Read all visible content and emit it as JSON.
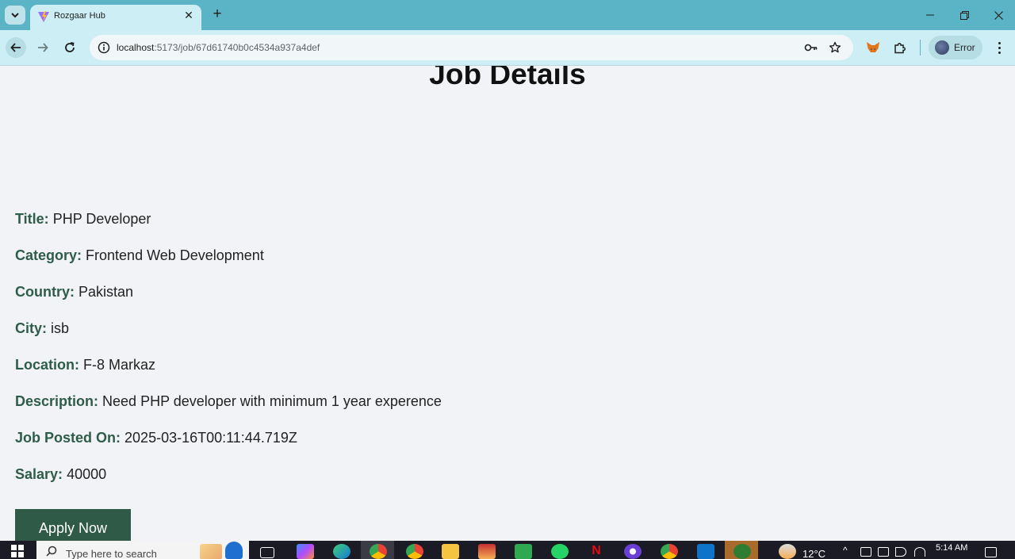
{
  "browser": {
    "tab_title": "Rozgaar Hub",
    "url_host": "localhost",
    "url_rest": ":5173/job/67d61740b0c4534a937a4def",
    "profile_label": "Error"
  },
  "page": {
    "heading": "Job Details",
    "fields": [
      {
        "label": "Title:",
        "value": "PHP Developer"
      },
      {
        "label": "Category:",
        "value": "Frontend Web Development"
      },
      {
        "label": "Country:",
        "value": "Pakistan"
      },
      {
        "label": "City:",
        "value": "isb"
      },
      {
        "label": "Location:",
        "value": "F-8 Markaz"
      },
      {
        "label": "Description:",
        "value": "Need PHP developer with minimum 1 year experence"
      },
      {
        "label": "Job Posted On:",
        "value": "2025-03-16T00:11:44.719Z"
      },
      {
        "label": "Salary:",
        "value": "40000"
      }
    ],
    "apply_button": "Apply Now"
  },
  "taskbar": {
    "search_placeholder": "Type here to search",
    "weather": "12°C",
    "time": "5:14 AM"
  },
  "colors": {
    "tab_strip": "#5ab4c5",
    "toolbar": "#cdeef4",
    "page_bg": "#f1f3f6",
    "label_green": "#2f5c49",
    "button_green": "#2e5a47"
  }
}
